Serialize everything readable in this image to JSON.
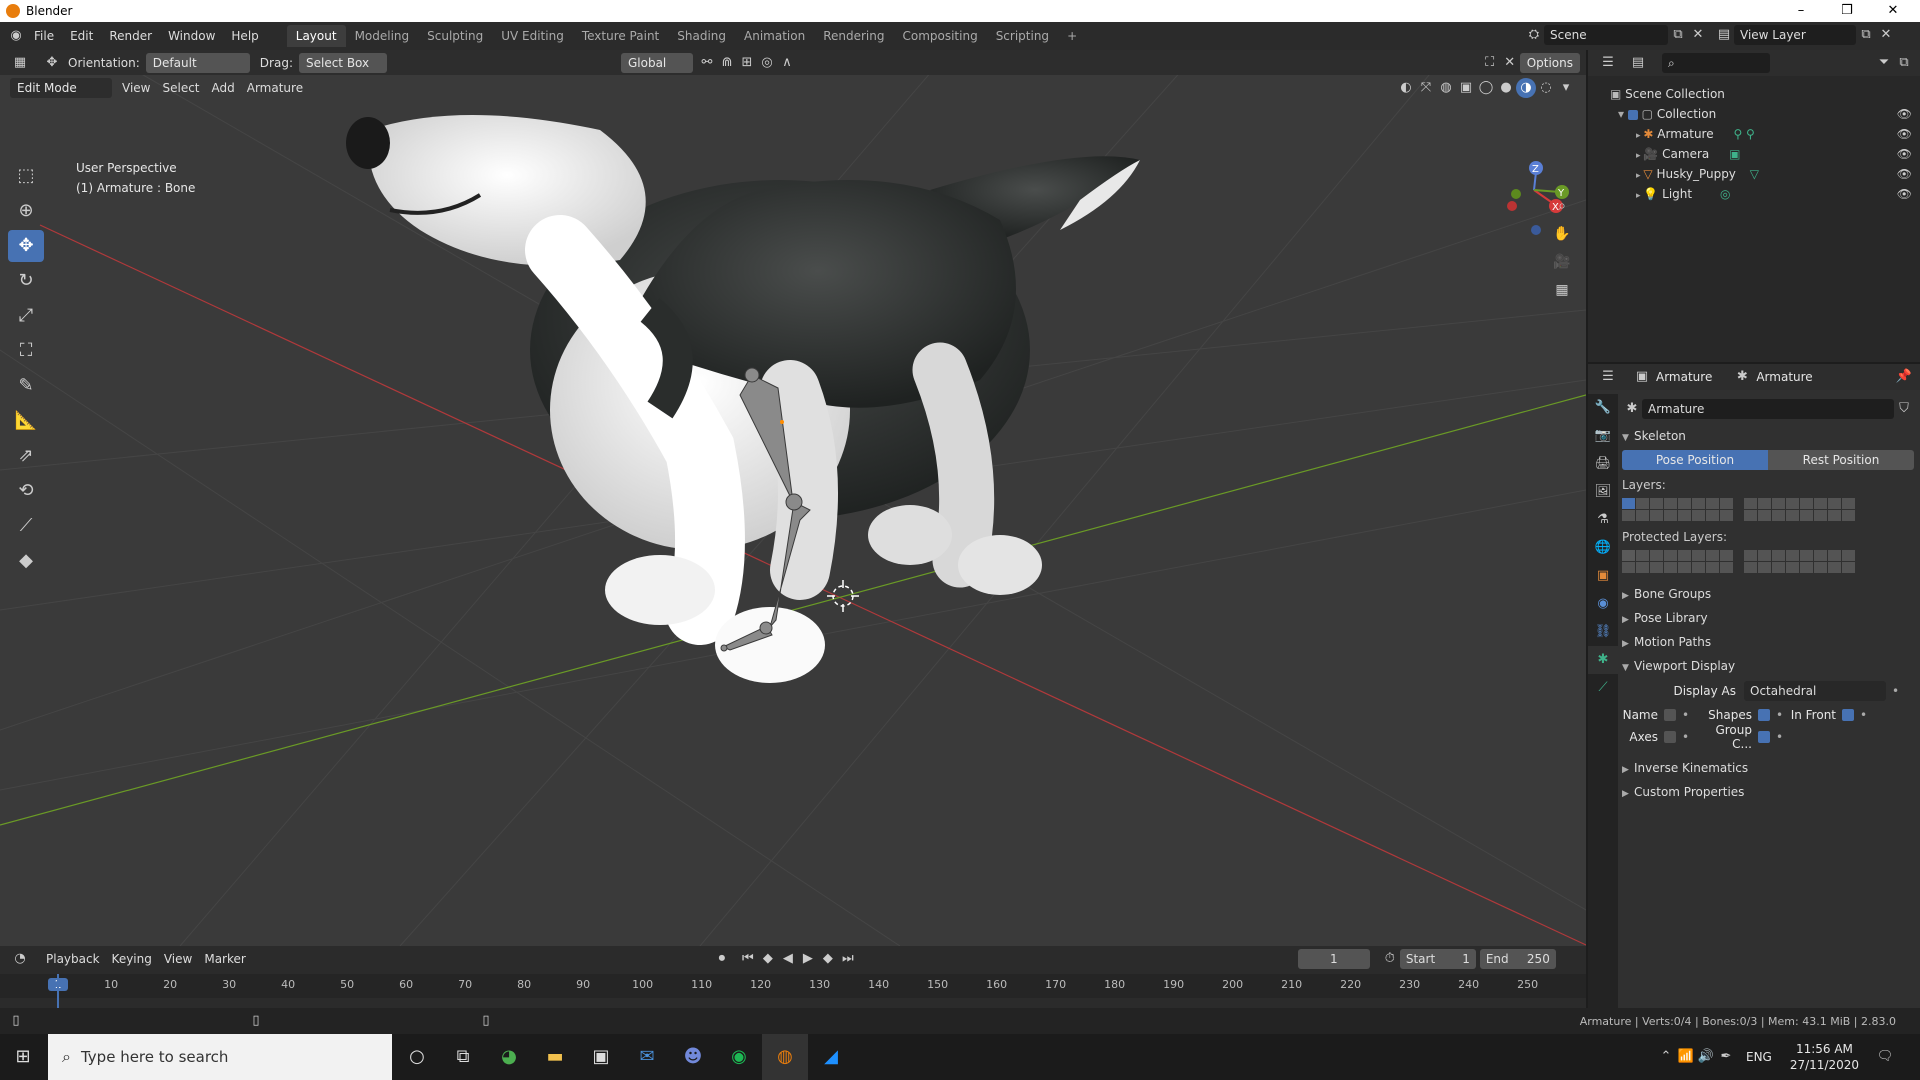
{
  "window": {
    "title": "Blender",
    "min": "–",
    "max": "❒",
    "close": "✕"
  },
  "menu": [
    "File",
    "Edit",
    "Render",
    "Window",
    "Help"
  ],
  "workspaces": [
    "Layout",
    "Modeling",
    "Sculpting",
    "UV Editing",
    "Texture Paint",
    "Shading",
    "Animation",
    "Rendering",
    "Compositing",
    "Scripting"
  ],
  "add_workspace": "+",
  "scene": {
    "name": "Scene",
    "view_layer": "View Layer"
  },
  "header": {
    "orientation_label": "Orientation:",
    "orientation_value": "Default",
    "drag_label": "Drag:",
    "drag_value": "Select Box",
    "transform": "Global",
    "options": "Options"
  },
  "header2": {
    "mode": "Edit Mode",
    "menus": [
      "View",
      "Select",
      "Add",
      "Armature"
    ]
  },
  "viewport_info": {
    "line1": "User Perspective",
    "line2": "(1) Armature : Bone"
  },
  "gizmo_axes": {
    "z": "Z",
    "y": "Y",
    "x": "X"
  },
  "outliner": {
    "root": "Scene Collection",
    "collection": "Collection",
    "items": [
      "Armature",
      "Camera",
      "Husky_Puppy",
      "Light"
    ]
  },
  "properties": {
    "breadcrumb_object": "Armature",
    "breadcrumb_data": "Armature",
    "datablock": "Armature",
    "skeleton": "Skeleton",
    "pose_position": "Pose Position",
    "rest_position": "Rest Position",
    "layers": "Layers:",
    "protected_layers": "Protected Layers:",
    "panels_collapsed": [
      "Bone Groups",
      "Pose Library",
      "Motion Paths"
    ],
    "viewport_display": "Viewport Display",
    "display_as_label": "Display As",
    "display_as_value": "Octahedral",
    "name_label": "Name",
    "shapes_label": "Shapes",
    "in_front_label": "In Front",
    "axes_label": "Axes",
    "group_colors_label": "Group C...",
    "panels_bottom": [
      "Inverse Kinematics",
      "Custom Properties"
    ]
  },
  "timeline": {
    "menus": [
      "Playback",
      "Keying",
      "View",
      "Marker"
    ],
    "current_frame": "1",
    "start_label": "Start",
    "start_value": "1",
    "end_label": "End",
    "end_value": "250",
    "ruler": [
      "1",
      "10",
      "20",
      "30",
      "40",
      "50",
      "60",
      "70",
      "80",
      "90",
      "100",
      "110",
      "120",
      "130",
      "140",
      "150",
      "160",
      "170",
      "180",
      "190",
      "200",
      "210",
      "220",
      "230",
      "240",
      "250"
    ]
  },
  "status": "Armature | Verts:0/4 | Bones:0/3 | Mem: 43.1 MiB | 2.83.0",
  "taskbar": {
    "search_placeholder": "Type here to search",
    "lang": "ENG",
    "time": "11:56 AM",
    "date": "27/11/2020"
  },
  "colors": {
    "accent": "#4772b3",
    "x_axis": "#d63a3a",
    "y_axis": "#6a9a26",
    "bone": "#888888"
  }
}
